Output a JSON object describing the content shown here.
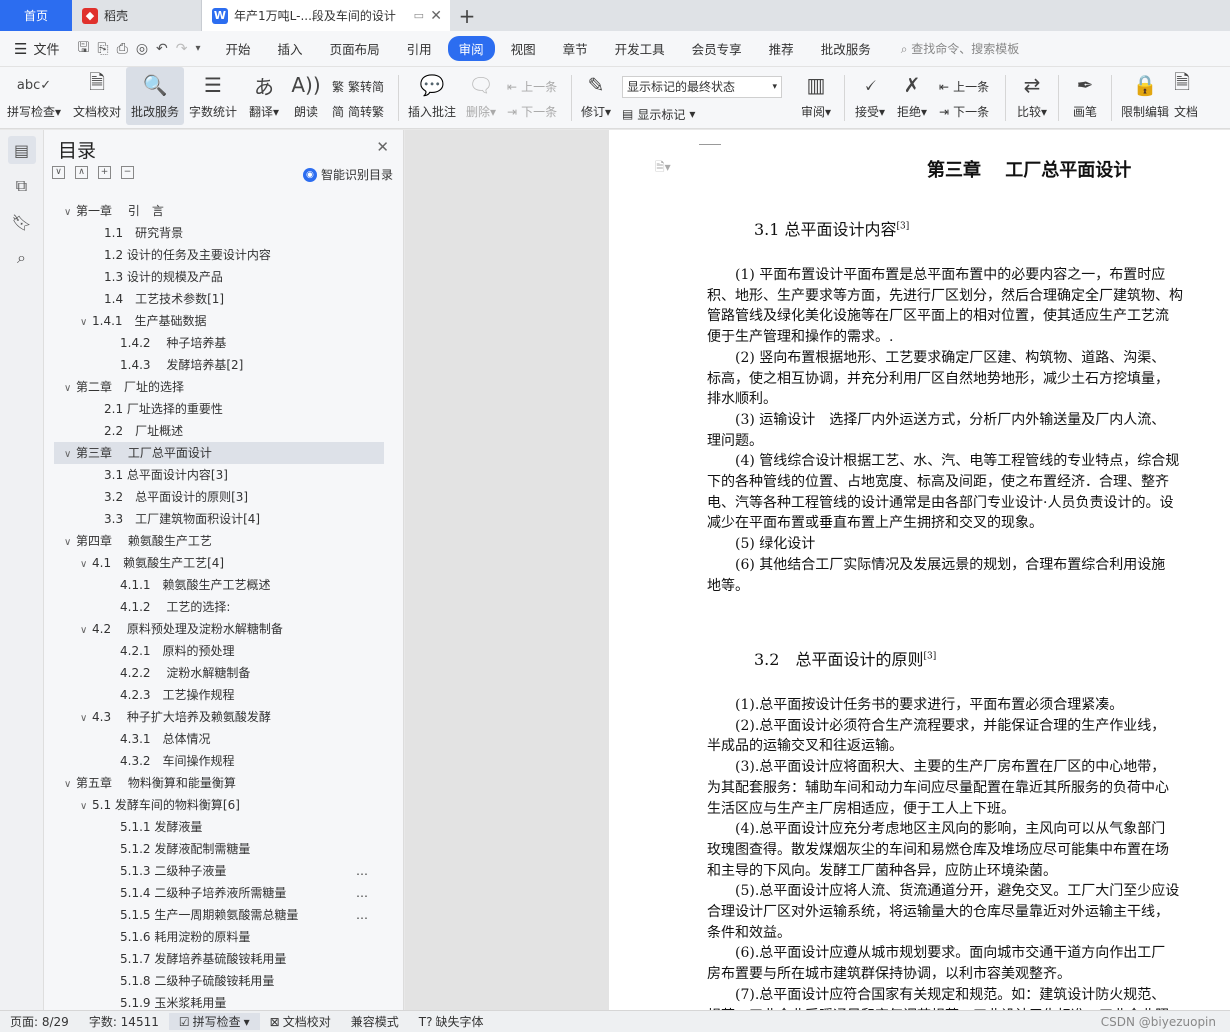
{
  "tabs": {
    "home": "首页",
    "daoke": "稻壳",
    "doc": "年产1万吨L-...段及车间的设计"
  },
  "menubar": {
    "file": "文件",
    "items": [
      "开始",
      "插入",
      "页面布局",
      "引用",
      "审阅",
      "视图",
      "章节",
      "开发工具",
      "会员专享",
      "推荐",
      "批改服务"
    ],
    "active": "审阅",
    "search": "查找命令、搜索模板"
  },
  "ribbon": {
    "spell": "拼写检查",
    "proof": "文档校对",
    "review_service": "批改服务",
    "wordcount": "字数统计",
    "translate": "翻译",
    "read": "朗读",
    "trad": "繁转简",
    "simp": "简转繁",
    "insert_comment": "插入批注",
    "delete": "删除",
    "prev": "上一条",
    "next": "下一条",
    "revise": "修订",
    "markup_select": "显示标记的最终状态",
    "show_markup": "显示标记",
    "review": "审阅",
    "accept": "接受",
    "reject": "拒绝",
    "prev2": "上一条",
    "next2": "下一条",
    "compare": "比较",
    "pen": "画笔",
    "restrict": "限制编辑",
    "doc_more": "文档"
  },
  "toc": {
    "title": "目录",
    "smart": "智能识别目录",
    "items": [
      {
        "text": "第一章　 引　言",
        "indent": 0,
        "arrow": "∨"
      },
      {
        "text": "1.1　研究背景",
        "indent": 2,
        "arrow": ""
      },
      {
        "text": "1.2  设计的任务及主要设计内容",
        "indent": 2,
        "arrow": ""
      },
      {
        "text": "1.3  设计的规模及产品",
        "indent": 2,
        "arrow": ""
      },
      {
        "text": "1.4　工艺技术参数[1]",
        "indent": 2,
        "arrow": ""
      },
      {
        "text": "1.4.1　生产基础数据",
        "indent": 1,
        "arrow": "∨"
      },
      {
        "text": "1.4.2　 种子培养基",
        "indent": 3,
        "arrow": ""
      },
      {
        "text": "1.4.3　 发酵培养基[2]",
        "indent": 3,
        "arrow": ""
      },
      {
        "text": "第二章　厂址的选择",
        "indent": 0,
        "arrow": "∨"
      },
      {
        "text": "2.1  厂址选择的重要性",
        "indent": 2,
        "arrow": ""
      },
      {
        "text": "2.2　厂址概述",
        "indent": 2,
        "arrow": ""
      },
      {
        "text": "第三章　 工厂总平面设计",
        "indent": 0,
        "arrow": "∨",
        "sel": true
      },
      {
        "text": "3.1 总平面设计内容[3]",
        "indent": 2,
        "arrow": ""
      },
      {
        "text": "3.2　总平面设计的原则[3]",
        "indent": 2,
        "arrow": ""
      },
      {
        "text": "3.3　工厂建筑物面积设计[4]",
        "indent": 2,
        "arrow": ""
      },
      {
        "text": "第四章　 赖氨酸生产工艺",
        "indent": 0,
        "arrow": "∨"
      },
      {
        "text": "4.1　赖氨酸生产工艺[4]",
        "indent": 1,
        "arrow": "∨"
      },
      {
        "text": "4.1.1　赖氨酸生产工艺概述",
        "indent": 3,
        "arrow": ""
      },
      {
        "text": "4.1.2　 工艺的选择:",
        "indent": 3,
        "arrow": ""
      },
      {
        "text": "4.2　 原料预处理及淀粉水解糖制备",
        "indent": 1,
        "arrow": "∨"
      },
      {
        "text": "4.2.1　原料的预处理",
        "indent": 3,
        "arrow": ""
      },
      {
        "text": "4.2.2　 淀粉水解糖制备",
        "indent": 3,
        "arrow": ""
      },
      {
        "text": "4.2.3　工艺操作规程",
        "indent": 3,
        "arrow": ""
      },
      {
        "text": "4.3　 种子扩大培养及赖氨酸发酵",
        "indent": 1,
        "arrow": "∨"
      },
      {
        "text": "4.3.1　总体情况",
        "indent": 3,
        "arrow": ""
      },
      {
        "text": "4.3.2　车间操作规程",
        "indent": 3,
        "arrow": ""
      },
      {
        "text": "第五章　 物料衡算和能量衡算",
        "indent": 0,
        "arrow": "∨"
      },
      {
        "text": "5.1 发酵车间的物料衡算[6]",
        "indent": 1,
        "arrow": "∨"
      },
      {
        "text": "5.1.1 发酵液量",
        "indent": 3,
        "arrow": ""
      },
      {
        "text": "5.1.2 发酵液配制需糖量",
        "indent": 3,
        "arrow": ""
      },
      {
        "text": "5.1.3 二级种子液量",
        "indent": 3,
        "arrow": "",
        "more": true
      },
      {
        "text": "5.1.4 二级种子培养液所需糖量",
        "indent": 3,
        "arrow": "",
        "more": true
      },
      {
        "text": "5.1.5 生产一周期赖氨酸需总糖量",
        "indent": 3,
        "arrow": "",
        "more": true
      },
      {
        "text": "5.1.6  耗用淀粉的原料量",
        "indent": 3,
        "arrow": ""
      },
      {
        "text": "5.1.7  发酵培养基硫酸铵耗用量",
        "indent": 3,
        "arrow": ""
      },
      {
        "text": "5.1.8  二级种子硫酸铵耗用量",
        "indent": 3,
        "arrow": ""
      },
      {
        "text": "5.1.9  玉米浆耗用量",
        "indent": 3,
        "arrow": ""
      }
    ]
  },
  "doc": {
    "chapter": "第三章　 工厂总平面设计",
    "s31": "3.1 总平面设计内容",
    "s31_ref": "[3]",
    "s32": "3.2　总平面设计的原则",
    "s32_ref": "[3]",
    "para1": [
      "　　(1) 平面布置设计平面布置是总平面布置中的必要内容之一，布置时应",
      "积、地形、生产要求等方面，先进行厂区划分，然后合理确定全厂建筑物、构",
      "管路管线及绿化美化设施等在厂区平面上的相对位置，使其适应生产工艺流",
      "便于生产管理和操作的需求。.",
      "　　(2) 竖向布置根据地形、工艺要求确定厂区建、构筑物、道路、沟渠、",
      "标高，使之相互协调，并充分利用厂区自然地势地形，减少土石方挖填量，",
      "排水顺利。",
      "　　(3) 运输设计　选择厂内外运送方式，分析厂内外输送量及厂内人流、",
      "理问题。",
      "　　(4) 管线综合设计根据工艺、水、汽、电等工程管线的专业特点，综合规",
      "下的各种管线的位置、占地宽度、标高及间距，使之布置经济．合理、整齐",
      "电、汽等各种工程管线的设计通常是由各部门专业设计·人员负责设计的。设",
      "减少在平面布置或垂直布置上产生拥挤和交叉的现象。",
      "　　(5) 绿化设计",
      "　　(6) 其他结合工厂实际情况及发展远景的规划，合理布置综合利用设施",
      "地等。"
    ],
    "para2": [
      "　　(1).总平面按设计任务书的要求进行，平面布置必须合理紧凑。",
      "　　(2).总平面设计必须符合生产流程要求，并能保证合理的生产作业线，",
      "半成品的运输交叉和往返运输。",
      "　　(3).总平面设计应将面积大、主要的生产厂房布置在厂区的中心地带，",
      "为其配套服务：辅助车间和动力车间应尽量配置在靠近其所服务的负荷中心",
      "生活区应与生产主厂房相适应，便于工人上下班。",
      "　　(4).总平面设计应充分考虑地区主风向的影响，主风向可以从气象部门",
      "玫瑰图查得。散发煤烟灰尘的车间和易燃仓库及堆场应尽可能集中布置在场",
      "和主导的下风向。发酵工厂菌种各异，应防止环境染菌。",
      "　　(5).总平面设计应将人流、货流通道分开，避免交叉。工厂大门至少应设",
      "合理设计厂区对外运输系统，将运输量大的仓库尽量靠近对外运输主干线，",
      "条件和效益。",
      "　　(6).总平面设计应遵从城市规划要求。面向城市交通干道方向作出工厂",
      "房布置要与所在城市建筑群保持协调，以利市容美观整齐。",
      "　　(7).总平面设计应符合国家有关规定和规范。如：建筑设计防火规范、",
      "规范、工业企业采暖通风和空气调节规范、工业设计卫生标准、工业企业照"
    ]
  },
  "status": {
    "page": "页面: 8/29",
    "words": "字数: 14511",
    "spell": "拼写检查",
    "proof": "文档校对",
    "compat": "兼容模式",
    "font": "缺失字体",
    "watermark": "CSDN @biyezuopin"
  },
  "colors": {
    "accent": "#2c6df0",
    "active_tab_bg": "#2c6df0"
  }
}
